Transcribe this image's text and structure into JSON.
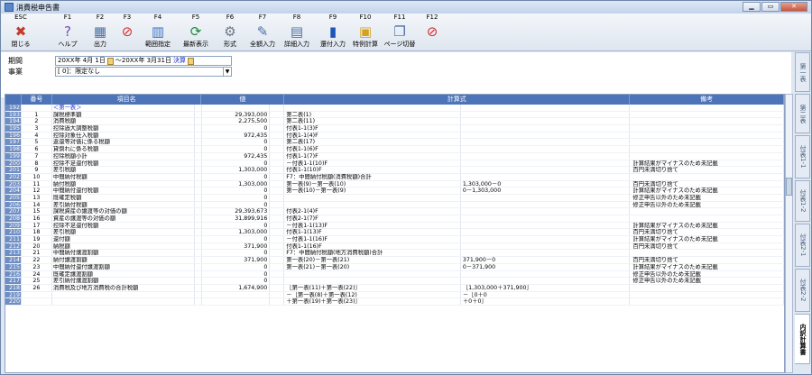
{
  "window": {
    "title": "消費税申告書"
  },
  "toolbar": [
    {
      "key": "ESC",
      "label": "閉じる",
      "icon": "close-app-icon"
    },
    {
      "key": "F1",
      "label": "ヘルプ",
      "icon": "help-icon"
    },
    {
      "key": "F2",
      "label": "出力",
      "icon": "print-icon"
    },
    {
      "key": "F3",
      "label": "",
      "icon": "prohibit-icon"
    },
    {
      "key": "F4",
      "label": "範囲指定",
      "icon": "calendar-icon"
    },
    {
      "key": "F5",
      "label": "最新表示",
      "icon": "refresh-icon"
    },
    {
      "key": "F6",
      "label": "形式",
      "icon": "gear-icon"
    },
    {
      "key": "F7",
      "label": "全額入力",
      "icon": "input-icon"
    },
    {
      "key": "F8",
      "label": "詳細入力",
      "icon": "detail-input-icon"
    },
    {
      "key": "F9",
      "label": "還付入力",
      "icon": "book-icon"
    },
    {
      "key": "F10",
      "label": "特例計算",
      "icon": "special-calc-icon"
    },
    {
      "key": "F11",
      "label": "ページ切替",
      "icon": "page-switch-icon"
    },
    {
      "key": "F12",
      "label": "",
      "icon": "prohibit-icon"
    }
  ],
  "form": {
    "period_label": "期間",
    "period_from": "20XX年 4月 1日",
    "period_to": "〜20XX年 3月31日",
    "kessan": "決算",
    "project_label": "事業",
    "project_value": "[ 0]：限定なし"
  },
  "grid": {
    "headers": {
      "no": "",
      "ban": "番号",
      "name": "項目名",
      "value": "値",
      "formula": "計算式",
      "remark": "備考"
    },
    "rows": [
      {
        "no": "192",
        "ban": "",
        "name": "＜第一表＞",
        "value": "",
        "f1": "",
        "f2": "",
        "rem": "",
        "sub": true
      },
      {
        "no": "193",
        "ban": "1",
        "name": "課税標準額",
        "value": "29,393,000",
        "f1": "第二表(1)",
        "f2": "",
        "rem": ""
      },
      {
        "no": "194",
        "ban": "2",
        "name": "消費税額",
        "value": "2,275,500",
        "f1": "第二表(11)",
        "f2": "",
        "rem": ""
      },
      {
        "no": "195",
        "ban": "3",
        "name": "控除過大調整税額",
        "value": "0",
        "f1": "付表1-1(3)F",
        "f2": "",
        "rem": ""
      },
      {
        "no": "196",
        "ban": "4",
        "name": "控除対象仕入税額",
        "value": "972,435",
        "f1": "付表1-1(4)F",
        "f2": "",
        "rem": ""
      },
      {
        "no": "197",
        "ban": "5",
        "name": "返還等対価に係る税額",
        "value": "0",
        "f1": "第二表(17)",
        "f2": "",
        "rem": ""
      },
      {
        "no": "198",
        "ban": "6",
        "name": "貸倒れに係る税額",
        "value": "0",
        "f1": "付表1-1(6)F",
        "f2": "",
        "rem": ""
      },
      {
        "no": "199",
        "ban": "7",
        "name": "控除税額小計",
        "value": "972,435",
        "f1": "付表1-1(7)F",
        "f2": "",
        "rem": ""
      },
      {
        "no": "200",
        "ban": "8",
        "name": "控除不足還付税額",
        "value": "0",
        "f1": "－付表1-1(10)F",
        "f2": "",
        "rem": "計算結果がマイナスのため未記載"
      },
      {
        "no": "201",
        "ban": "9",
        "name": "差引税額",
        "value": "1,303,000",
        "f1": "付表1-1(10)F",
        "f2": "",
        "rem": "百円未満切り捨て"
      },
      {
        "no": "202",
        "ban": "10",
        "name": "中間納付税額",
        "value": "0",
        "f1": "F7：中間納付税額(消費税額)合計",
        "f2": "",
        "rem": ""
      },
      {
        "no": "203",
        "ban": "11",
        "name": "納付税額",
        "value": "1,303,000",
        "f1": "第一表(9)－第一表(10)",
        "f2": "1,303,000－0",
        "rem": "百円未満切り捨て"
      },
      {
        "no": "204",
        "ban": "12",
        "name": "中間納付還付税額",
        "value": "0",
        "f1": "第一表(10)－第一表(9)",
        "f2": "0－1,303,000",
        "rem": "計算結果がマイナスのため未記載"
      },
      {
        "no": "205",
        "ban": "13",
        "name": "既確定税額",
        "value": "0",
        "f1": "",
        "f2": "",
        "rem": "修正申告以外のため未記載"
      },
      {
        "no": "206",
        "ban": "14",
        "name": "差引納付税額",
        "value": "0",
        "f1": "",
        "f2": "",
        "rem": "修正申告以外のため未記載"
      },
      {
        "no": "207",
        "ban": "15",
        "name": "課税資産の譲渡等の対価の額",
        "value": "29,393,673",
        "f1": "付表2-1(4)F",
        "f2": "",
        "rem": ""
      },
      {
        "no": "208",
        "ban": "16",
        "name": "資産の譲渡等の対価の額",
        "value": "31,899,916",
        "f1": "付表2-1(7)F",
        "f2": "",
        "rem": ""
      },
      {
        "no": "209",
        "ban": "17",
        "name": "控除不足還付税額",
        "value": "0",
        "f1": "－付表1-1(13)F",
        "f2": "",
        "rem": "計算結果がマイナスのため未記載"
      },
      {
        "no": "210",
        "ban": "18",
        "name": "差引税額",
        "value": "1,303,000",
        "f1": "付表1-1(13)F",
        "f2": "",
        "rem": "百円未満切り捨て"
      },
      {
        "no": "211",
        "ban": "19",
        "name": "還付額",
        "value": "0",
        "f1": "－付表1-1(16)F",
        "f2": "",
        "rem": "計算結果がマイナスのため未記載"
      },
      {
        "no": "212",
        "ban": "20",
        "name": "納税額",
        "value": "371,900",
        "f1": "付表1-1(16)F",
        "f2": "",
        "rem": "百円未満切り捨て"
      },
      {
        "no": "213",
        "ban": "21",
        "name": "中間納付譲渡割額",
        "value": "0",
        "f1": "F7：中間納付税額(地方消費税額)合計",
        "f2": "",
        "rem": ""
      },
      {
        "no": "214",
        "ban": "22",
        "name": "納付譲渡割額",
        "value": "371,900",
        "f1": "第一表(20)－第一表(21)",
        "f2": "371,900－0",
        "rem": "百円未満切り捨て"
      },
      {
        "no": "215",
        "ban": "23",
        "name": "中間納付還付譲渡割額",
        "value": "0",
        "f1": "第一表(21)－第一表(20)",
        "f2": "0－371,900",
        "rem": "計算結果がマイナスのため未記載"
      },
      {
        "no": "216",
        "ban": "24",
        "name": "既確定譲渡割額",
        "value": "0",
        "f1": "",
        "f2": "",
        "rem": "修正申告以外のため未記載"
      },
      {
        "no": "217",
        "ban": "25",
        "name": "差引納付譲渡割額",
        "value": "0",
        "f1": "",
        "f2": "",
        "rem": "修正申告以外のため未記載"
      },
      {
        "no": "218",
        "ban": "26",
        "name": "消費税及び地方消費税の合計税額",
        "value": "1,674,900",
        "f1": "［第一表(11)＋第一表(22)］",
        "f2": "［1,303,000＋371,900］",
        "rem": ""
      },
      {
        "no": "219",
        "ban": "",
        "name": "",
        "value": "",
        "f1": "－［第一表(8)＋第一表(12)",
        "f2": "－［0＋0",
        "rem": ""
      },
      {
        "no": "220",
        "ban": "",
        "name": "",
        "value": "",
        "f1": "＋第一表(19)＋第一表(23)］",
        "f2": "＋0＋0］",
        "rem": ""
      }
    ]
  },
  "tabs": [
    {
      "label": "第一表",
      "active": false
    },
    {
      "label": "第二表",
      "active": false
    },
    {
      "label": "付表1-1",
      "active": false
    },
    {
      "label": "付表1-2",
      "active": false
    },
    {
      "label": "付表2-1",
      "active": false
    },
    {
      "label": "付表2-2",
      "active": false
    },
    {
      "label": "内訳計算書",
      "active": true
    }
  ]
}
